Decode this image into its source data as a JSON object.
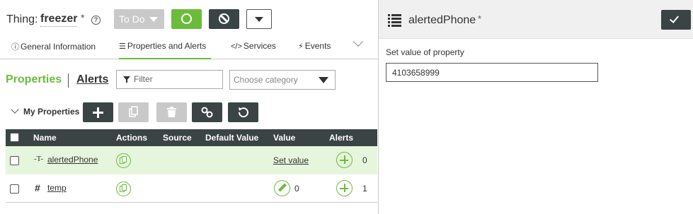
{
  "header": {
    "thing_label": "Thing:",
    "thing_name": "freezer",
    "unsaved_mark": "*",
    "help_glyph": "?",
    "state": "To Do",
    "more_menu": "chevron-down-icon"
  },
  "tabs": [
    {
      "label": "General Information",
      "icon": "info-icon"
    },
    {
      "label": "Properties and Alerts",
      "icon": "list-icon"
    },
    {
      "label": "Services",
      "icon": "code-icon"
    },
    {
      "label": "Events",
      "icon": "lightning-icon"
    }
  ],
  "subnav": {
    "properties": "Properties",
    "alerts": "Alerts"
  },
  "filter": {
    "placeholder": "Filter",
    "value": ""
  },
  "category": {
    "placeholder": "Choose category"
  },
  "group": {
    "label": "My Properties"
  },
  "table": {
    "columns": [
      "Name",
      "Actions",
      "Source",
      "Default Value",
      "Value",
      "Alerts"
    ],
    "rows": [
      {
        "type_glyph": "-T-",
        "name": "alertedPhone",
        "value_action": "Set value",
        "value": "",
        "alerts": "0",
        "selected": true
      },
      {
        "type_glyph": "#",
        "name": "temp",
        "value_action": "",
        "value": "0",
        "alerts": "1",
        "selected": false
      }
    ]
  },
  "side_panel": {
    "title": "alertedPhone",
    "unsaved_mark": "*",
    "field_label": "Set value of property",
    "field_value": "4103658999"
  },
  "colors": {
    "accent_green": "#6cbc3c",
    "dark_button": "#3b4444",
    "disabled_button": "#c9c9c9",
    "selected_row": "#e6f6dc"
  }
}
